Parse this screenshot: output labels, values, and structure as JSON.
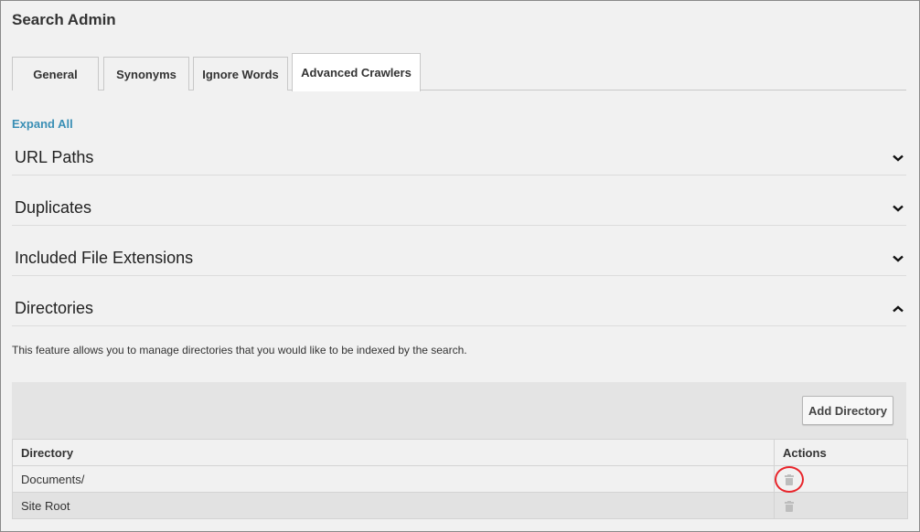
{
  "page": {
    "title": "Search Admin"
  },
  "tabs": [
    {
      "label": "General"
    },
    {
      "label": "Synonyms"
    },
    {
      "label": "Ignore Words"
    },
    {
      "label": "Advanced Crawlers",
      "active": true
    }
  ],
  "expand_all_label": "Expand All",
  "sections": [
    {
      "label": "URL Paths",
      "state": "collapsed",
      "icon": "chevron-down-icon"
    },
    {
      "label": "Duplicates",
      "state": "collapsed",
      "icon": "chevron-down-icon"
    },
    {
      "label": "Included File Extensions",
      "state": "collapsed",
      "icon": "chevron-down-icon"
    },
    {
      "label": "Directories",
      "state": "expanded",
      "icon": "chevron-up-icon"
    }
  ],
  "directories": {
    "description": "This feature allows you to manage directories that you would like to be indexed by the search.",
    "add_button_label": "Add Directory",
    "columns": [
      "Directory",
      "Actions"
    ],
    "rows": [
      {
        "directory": "Documents/",
        "action_icon": "trash-icon"
      },
      {
        "directory": "Site Root",
        "action_icon": "trash-icon"
      }
    ]
  },
  "colors": {
    "link": "#3a8fb5",
    "highlight_circle": "#e8252b",
    "background": "#f1f1f1"
  }
}
